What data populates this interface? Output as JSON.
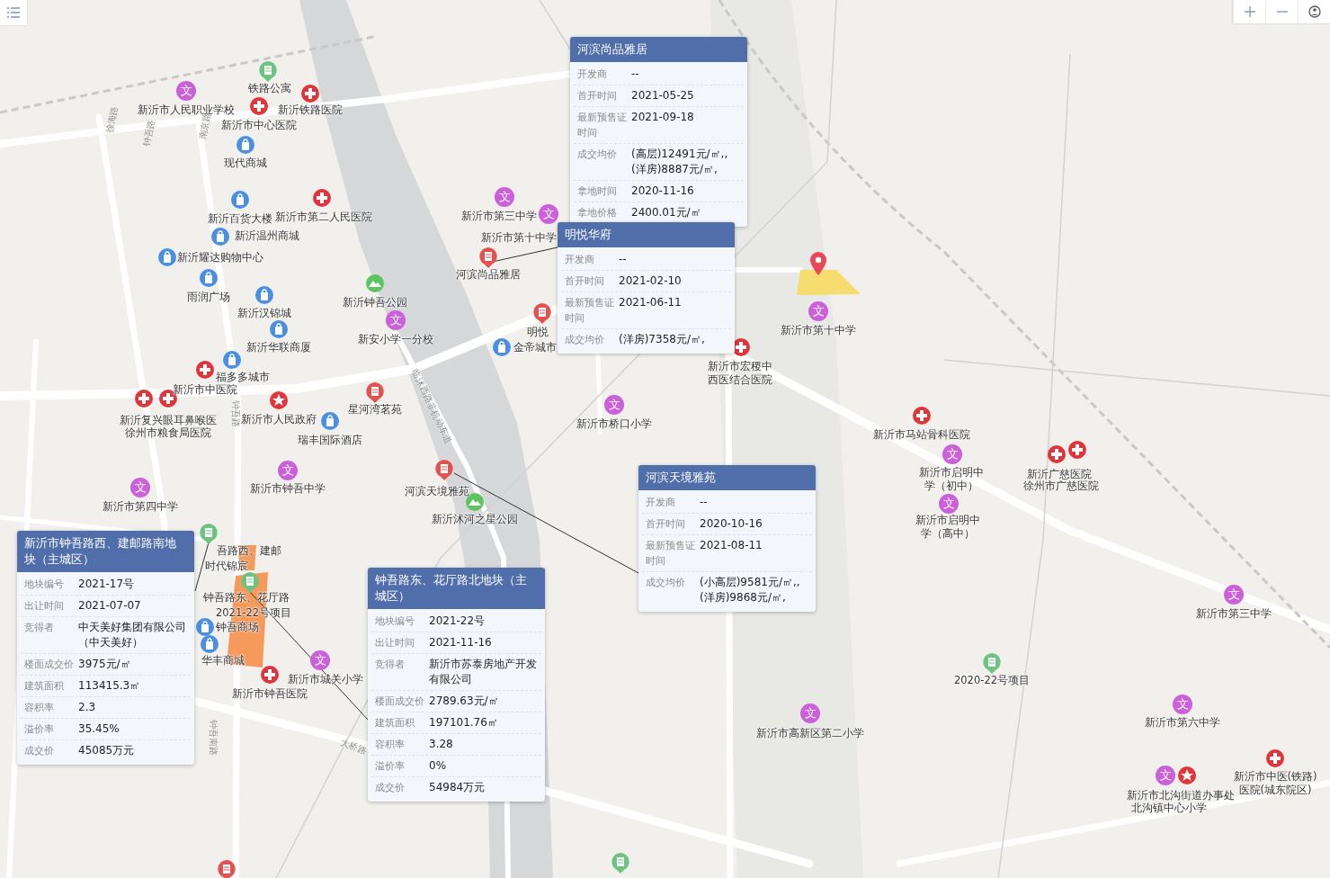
{
  "pois": [
    {
      "kind": "project",
      "name": "铁路公寓"
    },
    {
      "kind": "school",
      "name": "新沂市人民职业学校",
      "glyph": "文"
    },
    {
      "kind": "hospital",
      "name": "新沂铁路医院"
    },
    {
      "kind": "hospital",
      "name": "新沂市中心医院"
    },
    {
      "kind": "shop",
      "name": "现代商城"
    },
    {
      "kind": "shop",
      "name": "新沂百货大楼"
    },
    {
      "kind": "hospital",
      "name": "新沂市第二人民医院"
    },
    {
      "kind": "school",
      "name": "新沂市第三中学",
      "glyph": "文"
    },
    {
      "kind": "shop",
      "name": "新沂温州商城"
    },
    {
      "kind": "school",
      "name": "新沂市第十中学",
      "glyph": "文"
    },
    {
      "kind": "shop",
      "name": "新沂耀达购物中心"
    },
    {
      "kind": "residence",
      "name": "河滨尚品雅居"
    },
    {
      "kind": "shop",
      "name": "雨润广场"
    },
    {
      "kind": "park",
      "name": "新沂钟吾公园"
    },
    {
      "kind": "shop",
      "name": "新沂汉锦城"
    },
    {
      "kind": "school",
      "name": "新安小学一分校",
      "glyph": "文"
    },
    {
      "kind": "residence",
      "name": "明悦"
    },
    {
      "kind": "school",
      "name": "新沂市第十中学",
      "glyph": "文"
    },
    {
      "kind": "shop",
      "name": "新沂华联商厦"
    },
    {
      "kind": "shop",
      "name": "金帝城市"
    },
    {
      "kind": "shop",
      "name": "福多多城市"
    },
    {
      "kind": "hospital",
      "name": "新沂市宏稷中西医结合医院"
    },
    {
      "kind": "hospital",
      "name": "新沂市中医院"
    },
    {
      "kind": "residence",
      "name": "星河湾茗苑"
    },
    {
      "kind": "hospital",
      "name": "新沂复兴眼耳鼻喉医"
    },
    {
      "kind": "gov",
      "name": "新沂市人民政府"
    },
    {
      "kind": "school",
      "name": "新沂市桥口小学",
      "glyph": "文"
    },
    {
      "kind": "hospital",
      "name": "徐州市粮食局医院"
    },
    {
      "kind": "shop",
      "name": "瑞丰国际酒店"
    },
    {
      "kind": "hospital",
      "name": "新沂市马站骨科医院"
    },
    {
      "kind": "school",
      "name": "新沂市第四中学",
      "glyph": "文"
    },
    {
      "kind": "school",
      "name": "新沂市钟吾中学",
      "glyph": "文"
    },
    {
      "kind": "residence",
      "name": "河滨天境雅苑"
    },
    {
      "kind": "school",
      "name": "新沂市启明中学（初中）",
      "glyph": "文"
    },
    {
      "kind": "hospital",
      "name": "新沂广慈医院"
    },
    {
      "kind": "hospital",
      "name": "徐州市广慈医院"
    },
    {
      "kind": "park",
      "name": "新沂沭河之星公园"
    },
    {
      "kind": "school",
      "name": "新沂市启明中学（高中）",
      "glyph": "文"
    },
    {
      "kind": "project",
      "name": "吾路西、建邮"
    },
    {
      "kind": "label",
      "name": "时代锦宸"
    },
    {
      "kind": "project",
      "name": "钟吾路东、花厅路"
    },
    {
      "kind": "label",
      "name": "2021-22号项目"
    },
    {
      "kind": "school",
      "name": "新沂市第三中学",
      "glyph": "文"
    },
    {
      "kind": "shop",
      "name": "钟吾商场"
    },
    {
      "kind": "shop",
      "name": "华丰商城"
    },
    {
      "kind": "school",
      "name": "新沂市城关小学",
      "glyph": "文"
    },
    {
      "kind": "project",
      "name": "2020-22号项目"
    },
    {
      "kind": "hospital",
      "name": "新沂市钟吾医院"
    },
    {
      "kind": "school",
      "name": "新沂市高新区第二小学",
      "glyph": "文"
    },
    {
      "kind": "school",
      "name": "新沂市第六中学",
      "glyph": "文"
    },
    {
      "kind": "hospital",
      "name": "新沂市中医(铁路)医院(城东院区)"
    },
    {
      "kind": "gov",
      "name": "新沂市北沟街道办事处"
    },
    {
      "kind": "school",
      "name": "北沟镇中心小学",
      "glyph": "文"
    },
    {
      "kind": "residence"
    },
    {
      "kind": "project"
    }
  ],
  "road_labels": [
    "徐海路",
    "钟吾路",
    "南京路",
    "钟吾路",
    "临沭西路非机动车道",
    "钟吾南路",
    "大桥路"
  ],
  "popups": [
    {
      "title": "河滨尚品雅居",
      "rows": [
        {
          "label": "开发商",
          "value": "--"
        },
        {
          "label": "首开时间",
          "value": "2021-05-25"
        },
        {
          "label": "最新预售证时间",
          "value": "2021-09-18"
        },
        {
          "label": "成交均价",
          "value": "(高层)12491元/㎡,,(洋房)8887元/㎡,"
        },
        {
          "label": "拿地时间",
          "value": "2020-11-16"
        },
        {
          "label": "拿地价格",
          "value": "2400.01元/㎡"
        }
      ]
    },
    {
      "title": "明悦华府",
      "rows": [
        {
          "label": "开发商",
          "value": "--"
        },
        {
          "label": "首开时间",
          "value": "2021-02-10"
        },
        {
          "label": "最新预售证时间",
          "value": "2021-06-11"
        },
        {
          "label": "成交均价",
          "value": "(洋房)7358元/㎡,"
        }
      ]
    },
    {
      "title": "河滨天境雅苑",
      "rows": [
        {
          "label": "开发商",
          "value": "--"
        },
        {
          "label": "首开时间",
          "value": "2020-10-16"
        },
        {
          "label": "最新预售证时间",
          "value": "2021-08-11"
        },
        {
          "label": "成交均价",
          "value": "(小高层)9581元/㎡,,(洋房)9868元/㎡,"
        }
      ]
    },
    {
      "title": "新沂市钟吾路西、建邮路南地块（主城区）",
      "rows": [
        {
          "label": "地块编号",
          "value": "2021-17号"
        },
        {
          "label": "出让时间",
          "value": "2021-07-07"
        },
        {
          "label": "竞得者",
          "value": "中天美好集团有限公司（中天美好）"
        },
        {
          "label": "楼面成交价",
          "value": "3975元/㎡"
        },
        {
          "label": "建筑面积",
          "value": "113415.3㎡"
        },
        {
          "label": "容积率",
          "value": "2.3"
        },
        {
          "label": "溢价率",
          "value": "35.45%"
        },
        {
          "label": "成交价",
          "value": "45085万元"
        }
      ]
    },
    {
      "title": "钟吾路东、花厅路北地块（主城区）",
      "rows": [
        {
          "label": "地块编号",
          "value": "2021-22号"
        },
        {
          "label": "出让时间",
          "value": "2021-11-16"
        },
        {
          "label": "竞得者",
          "value": "新沂市苏泰房地产开发有限公司"
        },
        {
          "label": "楼面成交价",
          "value": "2789.63元/㎡"
        },
        {
          "label": "建筑面积",
          "value": "197101.76㎡"
        },
        {
          "label": "容积率",
          "value": "3.28"
        },
        {
          "label": "溢价率",
          "value": "0%"
        },
        {
          "label": "成交价",
          "value": "54984万元"
        }
      ]
    }
  ]
}
